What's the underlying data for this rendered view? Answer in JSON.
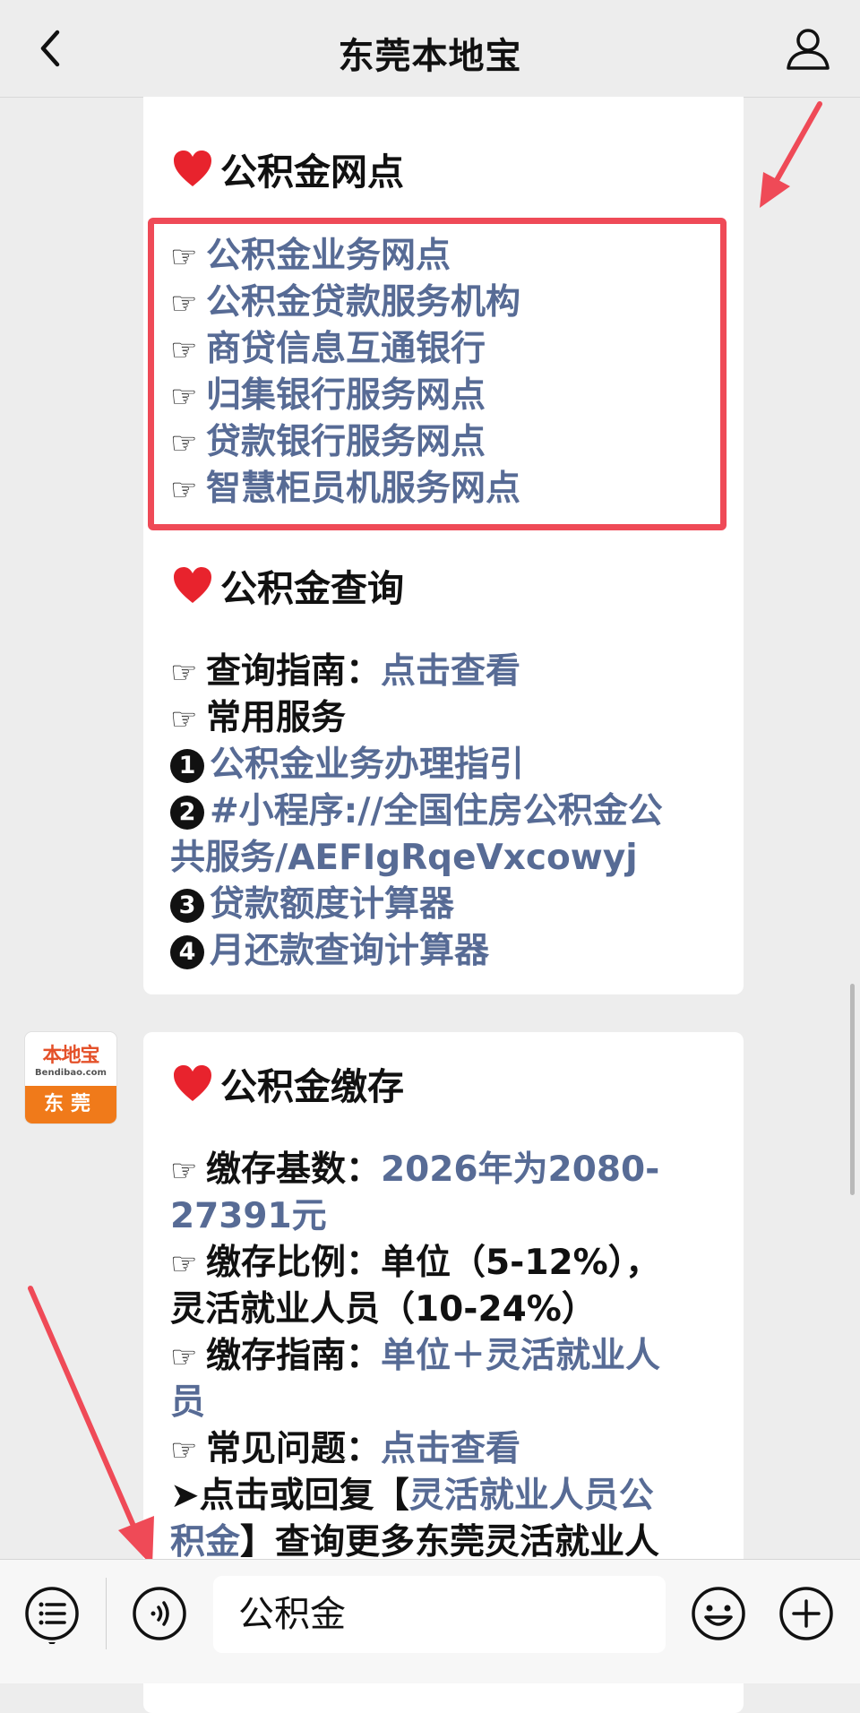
{
  "navbar": {
    "title": "东莞本地宝",
    "back_icon": "chevron-left-icon",
    "user_icon": "person-icon"
  },
  "section1": {
    "title": "公积金网点",
    "items": [
      "公积金业务网点",
      "公积金贷款服务机构",
      "商贷信息互通银行",
      "归集银行服务网点",
      "贷款银行服务网点",
      "智慧柜员机服务网点"
    ]
  },
  "section2": {
    "title": "公积金查询",
    "guide_label": "查询指南：",
    "guide_link": "点击查看",
    "services_label": "常用服务",
    "services": [
      {
        "num": "1",
        "text": "公积金业务办理指引"
      },
      {
        "num": "2",
        "text": "#小程序://全国住房公积金公",
        "text2": "共服务/AEFIgRqeVxcowyj"
      },
      {
        "num": "3",
        "text": "贷款额度计算器"
      },
      {
        "num": "4",
        "text": "月还款查询计算器"
      }
    ]
  },
  "avatar": {
    "logo": "本地宝",
    "sub": "Bendibao.com",
    "city": "东莞"
  },
  "section3": {
    "title": "公积金缴存",
    "base_label": "缴存基数：",
    "base_value_1": "2026年为2080-",
    "base_value_2": "27391元",
    "ratio_line_1": "缴存比例：单位（5-12%），",
    "ratio_line_2": "灵活就业人员（10-24%）",
    "guide_label": "缴存指南：",
    "guide_link_1": "单位＋灵活就业人",
    "guide_link_2": "员",
    "faq_label": "常见问题：",
    "faq_link": "点击查看",
    "more_prefix": "➤点击或回复【",
    "more_link_1": "灵活就业人员公",
    "more_link_2": "积金",
    "more_suffix": "】查询更多东莞灵活就业人"
  },
  "bottombar": {
    "menu_icon": "menu-list-icon",
    "voice_icon": "voice-icon",
    "input_value": "公积金",
    "emoji_icon": "smiley-icon",
    "plus_icon": "plus-icon"
  },
  "colors": {
    "link": "#576b95",
    "highlight_border": "#ef4a57",
    "arrow": "#ef4a57",
    "brand_orange": "#f07a1a"
  }
}
